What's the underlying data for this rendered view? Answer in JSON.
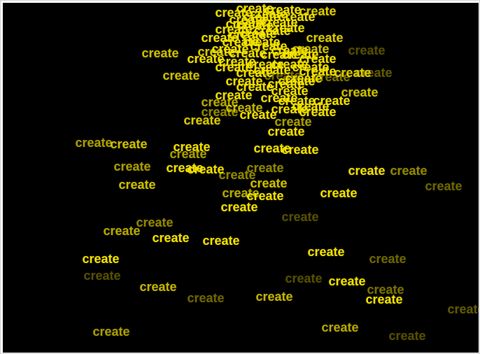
{
  "scene": {
    "background": "#000000",
    "word_color": "#f5e400",
    "word": "create",
    "word_count": 110
  }
}
